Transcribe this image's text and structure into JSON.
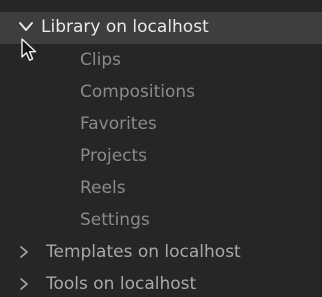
{
  "tree": {
    "library": {
      "label": "Library on localhost",
      "expanded": true,
      "children": [
        {
          "label": "Clips"
        },
        {
          "label": "Compositions"
        },
        {
          "label": "Favorites"
        },
        {
          "label": "Projects"
        },
        {
          "label": "Reels"
        },
        {
          "label": "Settings"
        }
      ]
    },
    "templates": {
      "label": "Templates on localhost",
      "expanded": false
    },
    "tools": {
      "label": "Tools on localhost",
      "expanded": false
    }
  },
  "icons": {
    "expanded": "chevron-down-icon",
    "collapsed": "chevron-right-icon",
    "cursor": "mouse-pointer-icon"
  },
  "colors": {
    "background": "#262626",
    "selected_row": "#3e3e3e",
    "primary_text": "#e9e9e9",
    "child_text": "#8b8b8b",
    "section_text": "#a9a9a9"
  }
}
